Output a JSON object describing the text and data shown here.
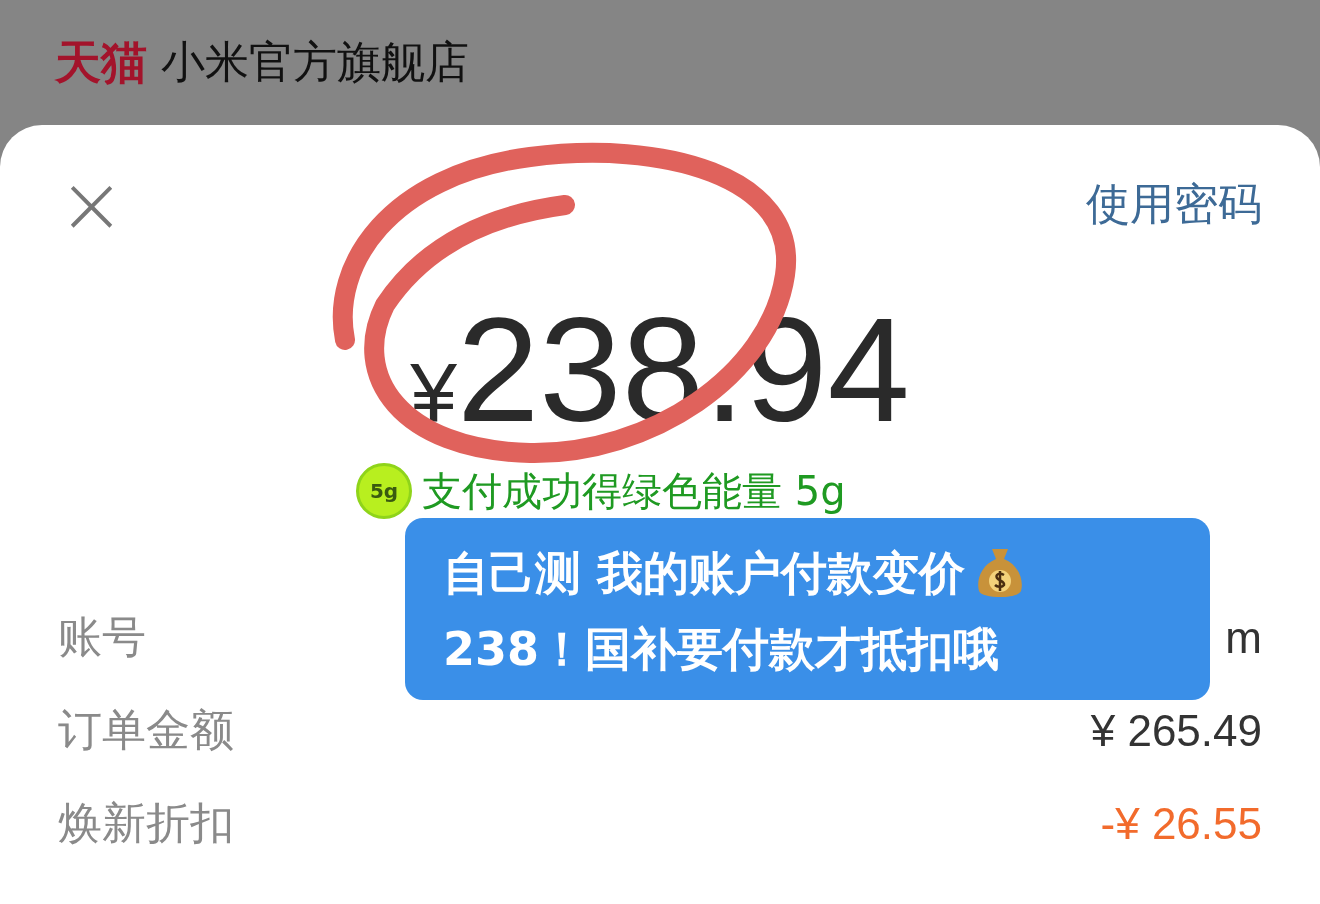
{
  "header": {
    "brand": "天猫",
    "store_name": "小米官方旗舰店"
  },
  "sheet": {
    "close": "×",
    "use_password": "使用密码",
    "currency": "¥",
    "amount": "238.94",
    "energy_badge": "5g",
    "energy_text": "支付成功得绿色能量 5g"
  },
  "details": [
    {
      "label": "账号",
      "value": "m",
      "kind": "normal"
    },
    {
      "label": "订单金额",
      "value": "¥ 265.49",
      "kind": "normal"
    },
    {
      "label": "焕新折扣",
      "value": "-¥ 26.55",
      "kind": "discount"
    }
  ],
  "annotation": {
    "lines": [
      "自己测 我的账户付款变价",
      "238！国补要付款才抵扣哦"
    ]
  }
}
